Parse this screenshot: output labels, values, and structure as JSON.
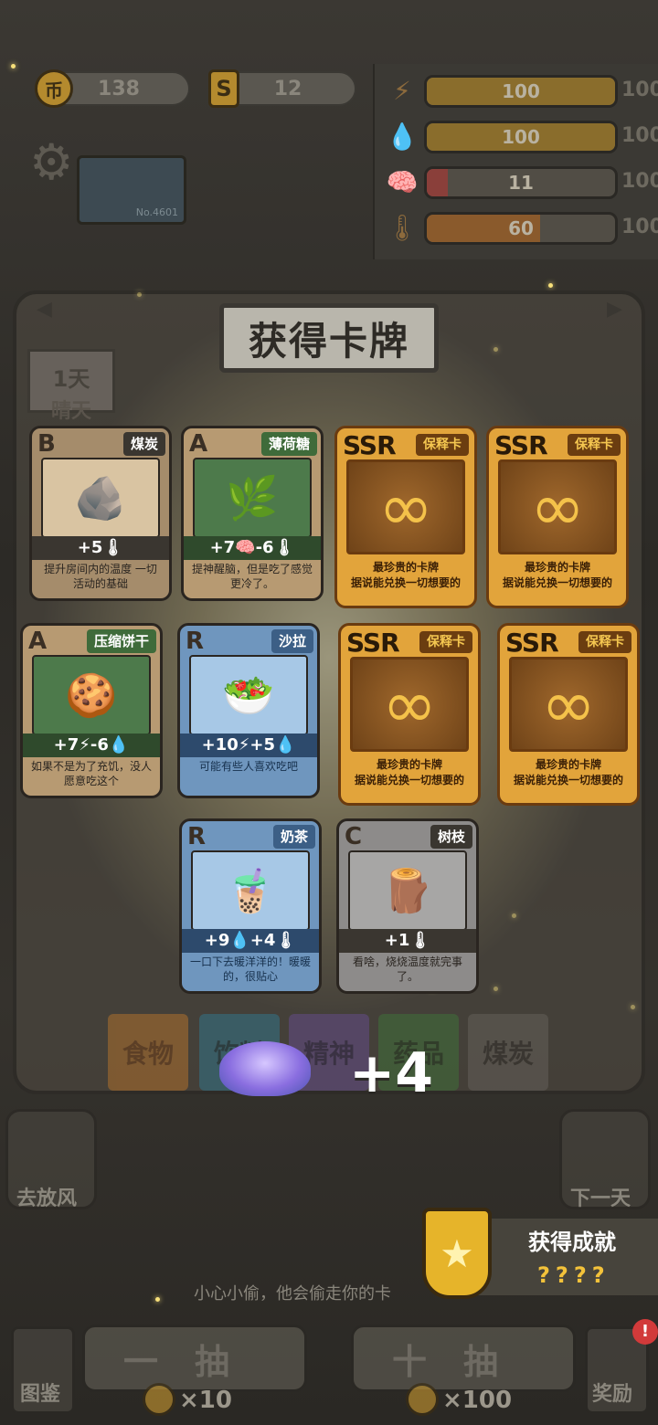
{
  "resources": {
    "coin_icon": "币",
    "coins": "138",
    "s_icon": "S",
    "scrolls": "12"
  },
  "stats": [
    {
      "icon": "lightning-icon",
      "glyph": "⚡",
      "value": "100",
      "max": "100",
      "fill": 1.0,
      "color": "#8a6d2c"
    },
    {
      "icon": "water-drop-icon",
      "glyph": "💧",
      "value": "100",
      "max": "100",
      "fill": 1.0,
      "color": "#8a6d2c"
    },
    {
      "icon": "brain-icon",
      "glyph": "🧠",
      "value": "11",
      "max": "100",
      "fill": 0.11,
      "color": "#8a3f3a"
    },
    {
      "icon": "thermometer-icon",
      "glyph": "🌡",
      "value": "60",
      "max": "100",
      "fill": 0.6,
      "color": "#8a5a2c"
    }
  ],
  "monitor_label": "No.4601",
  "day": {
    "label": "1天",
    "weather": "晴天"
  },
  "modal": {
    "title": "获得卡牌"
  },
  "cards": [
    {
      "rank": "B",
      "name": "煤炭",
      "art": "🪨",
      "stat": "+5🌡",
      "desc": "提升房间内的温度\n一切活动的基础"
    },
    {
      "rank": "A",
      "name": "薄荷糖",
      "art": "🌿",
      "stat": "+7🧠-6🌡",
      "desc": "提神醒脑，但是吃了感觉更冷了。"
    },
    {
      "rank": "SSR",
      "name": "保释卡",
      "art": "∞",
      "desc1": "最珍贵的卡牌",
      "desc2": "据说能兑换一切想要的"
    },
    {
      "rank": "SSR",
      "name": "保释卡",
      "art": "∞",
      "desc1": "最珍贵的卡牌",
      "desc2": "据说能兑换一切想要的"
    },
    {
      "rank": "A",
      "name": "压缩饼干",
      "art": "🍪",
      "stat": "+7⚡-6💧",
      "desc": "如果不是为了充饥，没人愿意吃这个"
    },
    {
      "rank": "R",
      "name": "沙拉",
      "art": "🥗",
      "stat": "+10⚡+5💧",
      "desc": "可能有些人喜欢吃吧"
    },
    {
      "rank": "SSR",
      "name": "保释卡",
      "art": "∞",
      "desc1": "最珍贵的卡牌",
      "desc2": "据说能兑换一切想要的"
    },
    {
      "rank": "SSR",
      "name": "保释卡",
      "art": "∞",
      "desc1": "最珍贵的卡牌",
      "desc2": "据说能兑换一切想要的"
    },
    {
      "rank": "R",
      "name": "奶茶",
      "art": "🧋",
      "stat": "+9💧+4🌡",
      "desc": "一口下去暖洋洋的！暖暖的，很贴心"
    },
    {
      "rank": "C",
      "name": "树枝",
      "art": "🪵",
      "stat": "+1🌡",
      "desc": "看啥，烧烧温度就完事了。"
    }
  ],
  "tabs": [
    {
      "label": "食物",
      "color": "#c47a2a"
    },
    {
      "label": "饮料",
      "color": "#2f7f9a"
    },
    {
      "label": "精神",
      "color": "#6a4f9a"
    },
    {
      "label": "药品",
      "color": "#3f7a3a"
    },
    {
      "label": "煤炭",
      "color": "#6a6660"
    }
  ],
  "reward": {
    "amount": "+4"
  },
  "side_buttons": {
    "left": "去放风",
    "right": "下一天"
  },
  "achievement": {
    "title": "获得成就",
    "desc": "????"
  },
  "tip": "小心小偷，他会偷走你的卡",
  "draw": {
    "single_label": "一抽",
    "ten_label": "十抽",
    "single_cost": "×10",
    "ten_cost": "×100"
  },
  "bottom_left": "图鉴",
  "bottom_right": "奖励",
  "badge": "!"
}
